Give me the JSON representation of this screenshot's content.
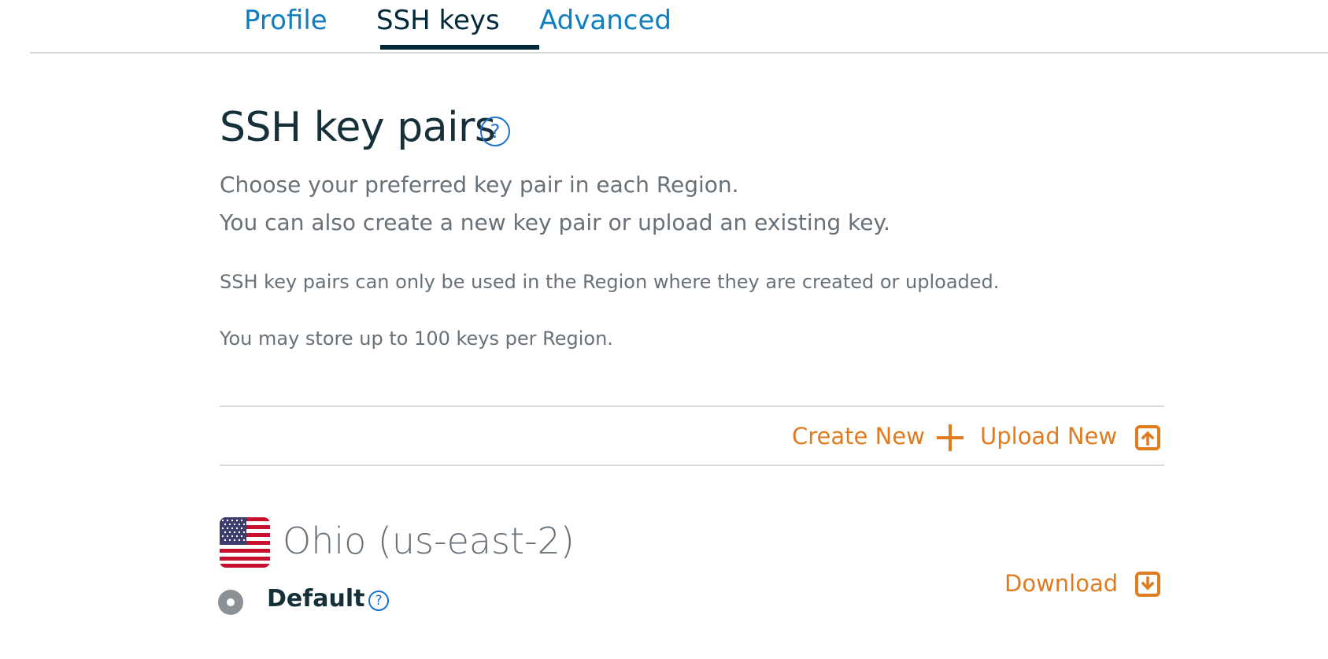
{
  "tabs": [
    {
      "label": "Profile",
      "active": false
    },
    {
      "label": "SSH keys",
      "active": true
    },
    {
      "label": "Advanced",
      "active": false
    }
  ],
  "header": {
    "title": "SSH key pairs",
    "help_symbol": "?",
    "description_line1": "Choose your preferred key pair in each Region.",
    "description_line2": "You can also create a new key pair or upload an existing key.",
    "note_region": "SSH key pairs can only be used in the Region where they are created or uploaded.",
    "note_limit": "You may store up to 100 keys per Region."
  },
  "actions": {
    "create_label": "Create New",
    "create_icon": "plus-icon",
    "upload_label": "Upload New",
    "upload_icon": "upload-icon"
  },
  "region": {
    "flag_icon": "us-flag-icon",
    "name": "Ohio (us-east-2)",
    "key_label": "Default",
    "key_selected": true,
    "download_label": "Download",
    "download_icon": "download-icon"
  },
  "colors": {
    "link_blue": "#0d7ebf",
    "action_orange": "#e07b20",
    "text_dark": "#16303a",
    "text_muted": "#687078",
    "help_blue": "#1b73d0"
  }
}
